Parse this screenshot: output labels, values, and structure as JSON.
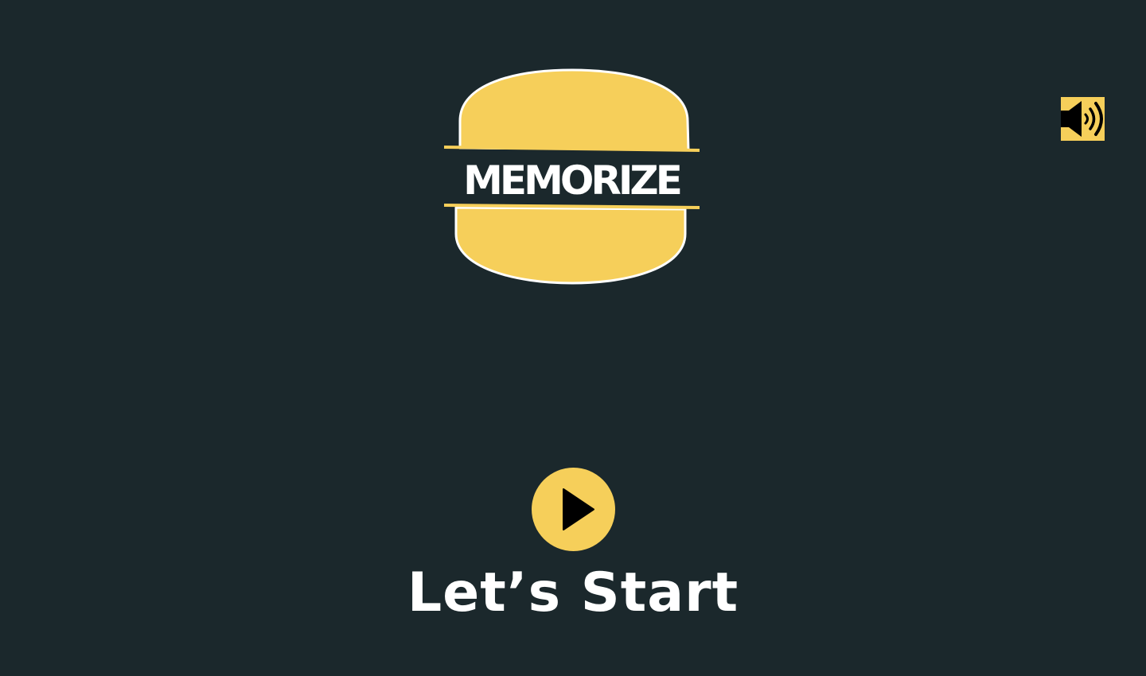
{
  "game": {
    "logo_text": "MEMORIZE",
    "start_label": "Let’s Start"
  },
  "controls": {
    "sound_icon": "speaker-volume-icon",
    "play_icon": "play-triangle-icon"
  },
  "colors": {
    "background": "#1b282c",
    "accent": "#f6cf5a",
    "text": "#ffffff",
    "icon": "#000000"
  }
}
